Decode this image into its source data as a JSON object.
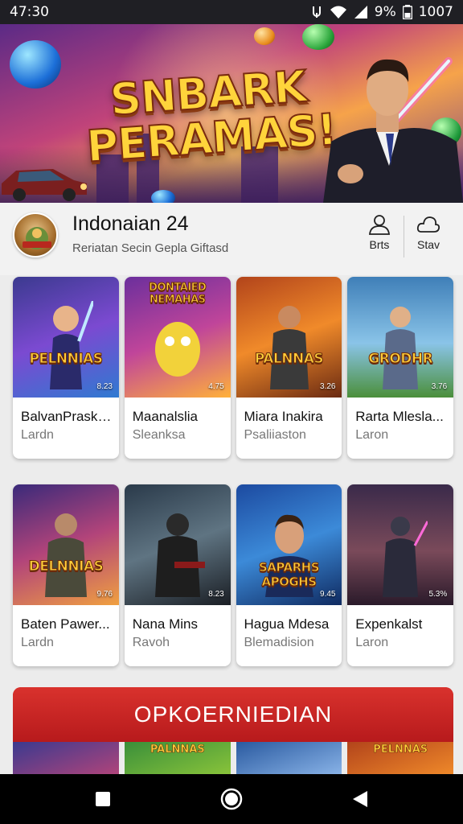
{
  "status_bar": {
    "time": "47:30",
    "battery_text": "9%",
    "extra_text": "1007",
    "icons": [
      "vpn-key-icon",
      "wifi-icon",
      "signal-icon",
      "battery-icon"
    ]
  },
  "banner": {
    "title_line1": "SNBARK",
    "title_line2": "PERAMAS!"
  },
  "profile": {
    "name": "Indonaian 24",
    "subtitle": "Reriatan Secin Gepla Giftasd",
    "actions": [
      {
        "label": "Brts",
        "icon": "person-icon"
      },
      {
        "label": "Stav",
        "icon": "cloud-icon"
      }
    ]
  },
  "row1": [
    {
      "title": "BalvanPraska...",
      "subtitle": "Lardn",
      "badge": "PELNNIAS",
      "rating": "8.23",
      "colors": [
        "#3b3a8f",
        "#7b4ad1",
        "#2f7ad1"
      ]
    },
    {
      "title": "Maanalslia",
      "subtitle": "Sleanksa",
      "badge": "DONTAIED NEMAHAS",
      "rating": "4.75",
      "colors": [
        "#6b2f9c",
        "#c0459a",
        "#ffb13a"
      ]
    },
    {
      "title": "Miara Inakira",
      "subtitle": "Psaliiaston",
      "badge": "PALNNAS",
      "rating": "3.26",
      "colors": [
        "#b2441b",
        "#f08a2a",
        "#6a2a12"
      ]
    },
    {
      "title": "Rarta Mlesla...",
      "subtitle": "Laron",
      "badge": "GRODHR",
      "rating": "3.76",
      "colors": [
        "#3f7fb8",
        "#8ac4e8",
        "#4b8f3a"
      ]
    }
  ],
  "row2": [
    {
      "title": "Baten Pawer...",
      "subtitle": "Lardn",
      "badge": "DELNNIAS",
      "rating": "9.76",
      "colors": [
        "#3a2a7a",
        "#b2447a",
        "#f0a040"
      ]
    },
    {
      "title": "Nana Mins",
      "subtitle": "Ravoh",
      "badge": "",
      "rating": "8.23",
      "colors": [
        "#2a3a4a",
        "#5f7482",
        "#1a1e24"
      ]
    },
    {
      "title": "Hagua Mdesa",
      "subtitle": "Blemadision",
      "badge": "SAPARHS APOGHS",
      "rating": "9.45",
      "colors": [
        "#1c4aa0",
        "#3c8ad8",
        "#0f2a60"
      ]
    },
    {
      "title": "Expenkalst",
      "subtitle": "Laron",
      "badge": "",
      "rating": "5.3%",
      "colors": [
        "#3a2a4a",
        "#7a4a5a",
        "#2a1a2a"
      ]
    }
  ],
  "promo": {
    "title": "OPKOERNIEDIAN",
    "strip_labels": [
      "",
      "PALNNAS",
      "",
      "PELNNAS"
    ]
  },
  "navbar": {
    "icons": [
      "recents-square-icon",
      "home-circle-icon",
      "back-triangle-icon"
    ]
  }
}
